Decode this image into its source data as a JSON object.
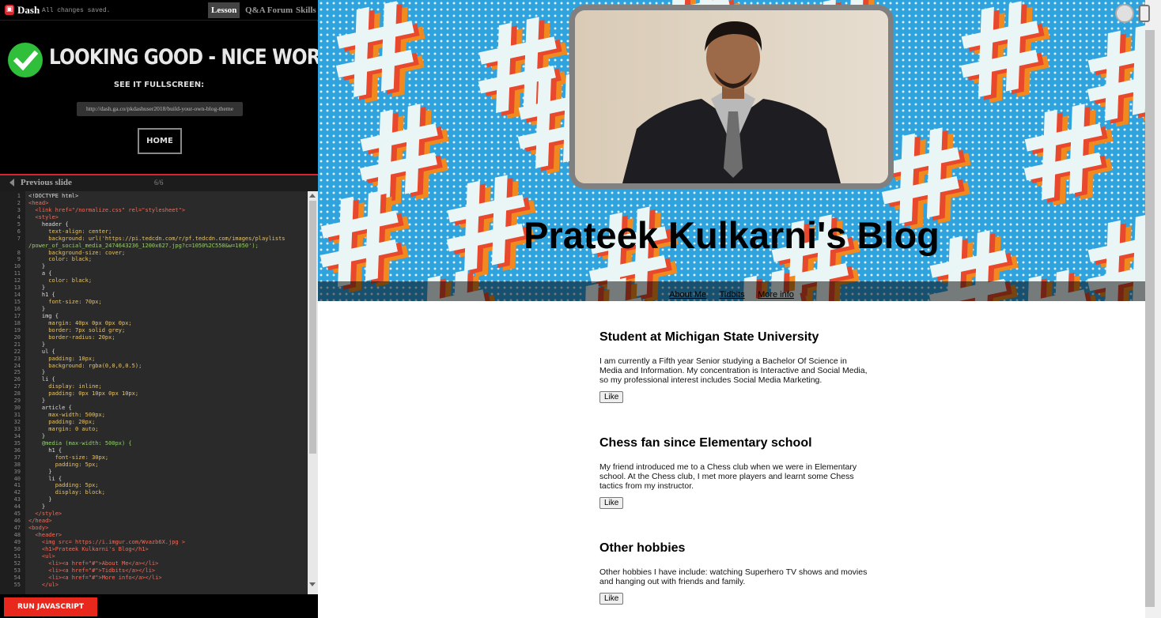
{
  "topbar": {
    "brand": "Dash",
    "logo_glyph": "▣",
    "saved_status": "All changes saved.",
    "tabs": [
      "Lesson",
      "Q&A Forum",
      "Skills"
    ]
  },
  "success": {
    "title": "LOOKING GOOD - NICE WORK!",
    "see_fullscreen": "SEE IT FULLSCREEN:",
    "url": "http://dash.ga.co/pkdashuser2018/build-your-own-blog-theme",
    "home_label": "HOME"
  },
  "slide_nav": {
    "prev_label": "Previous slide",
    "count": "6/6"
  },
  "code_lines": [
    "<!DOCTYPE html>",
    "<head>",
    "  <link href=\"/normalize.css\" rel=\"stylesheet\">",
    "  <style>",
    "    header {",
    "      text-align: center;",
    "      background: url('https://pi.tedcdn.com/r/pf.tedcdn.com/images/playlists",
    "/power_of_social_media_2474643236_1200x627.jpg?c=1050%2C550&w=1050');",
    "      background-size: cover;",
    "      color: black;",
    "    }",
    "    a {",
    "      color: black;",
    "    }",
    "    h1 {",
    "      font-size: 70px;",
    "    }",
    "    img {",
    "      margin: 40px 0px 0px 0px;",
    "      border: 7px solid grey;",
    "      border-radius: 20px;",
    "    }",
    "    ul {",
    "      padding: 10px;",
    "      background: rgba(0,0,0,0.5);",
    "    }",
    "    li {",
    "      display: inline;",
    "      padding: 0px 10px 0px 10px;",
    "    }",
    "    article {",
    "      max-width: 500px;",
    "      padding: 20px;",
    "      margin: 0 auto;",
    "    }",
    "    @media (max-width: 500px) {",
    "      h1 {",
    "        font-size: 30px;",
    "        padding: 5px;",
    "      }",
    "      li {",
    "        padding: 5px;",
    "        display: block;",
    "      }",
    "    }",
    "  </style>",
    "</head>",
    "<body>",
    "  <header>",
    "    <img src= https://i.imgur.com/Wvazb6X.jpg >",
    "    <h1>Prateek Kulkarni's Blog</h1>",
    "    <ul>",
    "      <li><a href=\"#\">About Me</a></li>",
    "      <li><a href=\"#\">Tidbits</a></li>",
    "      <li><a href=\"#\">More info</a></li>",
    "    </ul>"
  ],
  "code_line_numbers": [
    "1",
    "2",
    "3",
    "4",
    "5",
    "6",
    "7",
    "",
    "8",
    "9",
    "10",
    "11",
    "12",
    "13",
    "14",
    "15",
    "16",
    "17",
    "18",
    "19",
    "20",
    "21",
    "22",
    "23",
    "24",
    "25",
    "26",
    "27",
    "28",
    "29",
    "30",
    "31",
    "32",
    "33",
    "34",
    "35",
    "36",
    "37",
    "38",
    "39",
    "40",
    "41",
    "42",
    "43",
    "44",
    "45",
    "46",
    "47",
    "48",
    "49",
    "50",
    "51",
    "52",
    "53",
    "54",
    "55"
  ],
  "run_label": "RUN JAVASCRIPT",
  "preview": {
    "blog_title": "Prateek Kulkarni's Blog",
    "nav": [
      "About Me",
      "Tidbits",
      "More info"
    ],
    "articles": [
      {
        "title": "Student at Michigan State University",
        "body": "I am currently a Fifth year Senior studying a Bachelor Of Science in Media and Information. My concentration is Interactive and Social Media, so my professional interest includes Social Media Marketing.",
        "like": "Like"
      },
      {
        "title": "Chess fan since Elementary school",
        "body": "My friend introduced me to a Chess club when we were in Elementary school. At the Chess club, I met more players and learnt some Chess tactics from my instructor.",
        "like": "Like"
      },
      {
        "title": "Other hobbies",
        "body": "Other hobbies I have include: watching Superhero TV shows and movies and hanging out with friends and family.",
        "like": "Like"
      }
    ]
  },
  "colors": {
    "accent_red": "#e0262f",
    "success_green": "#2fbf3a",
    "header_blue": "#2ea3de"
  },
  "icons": [
    "check-icon",
    "chevron-left-icon",
    "device-toggle-icon"
  ]
}
